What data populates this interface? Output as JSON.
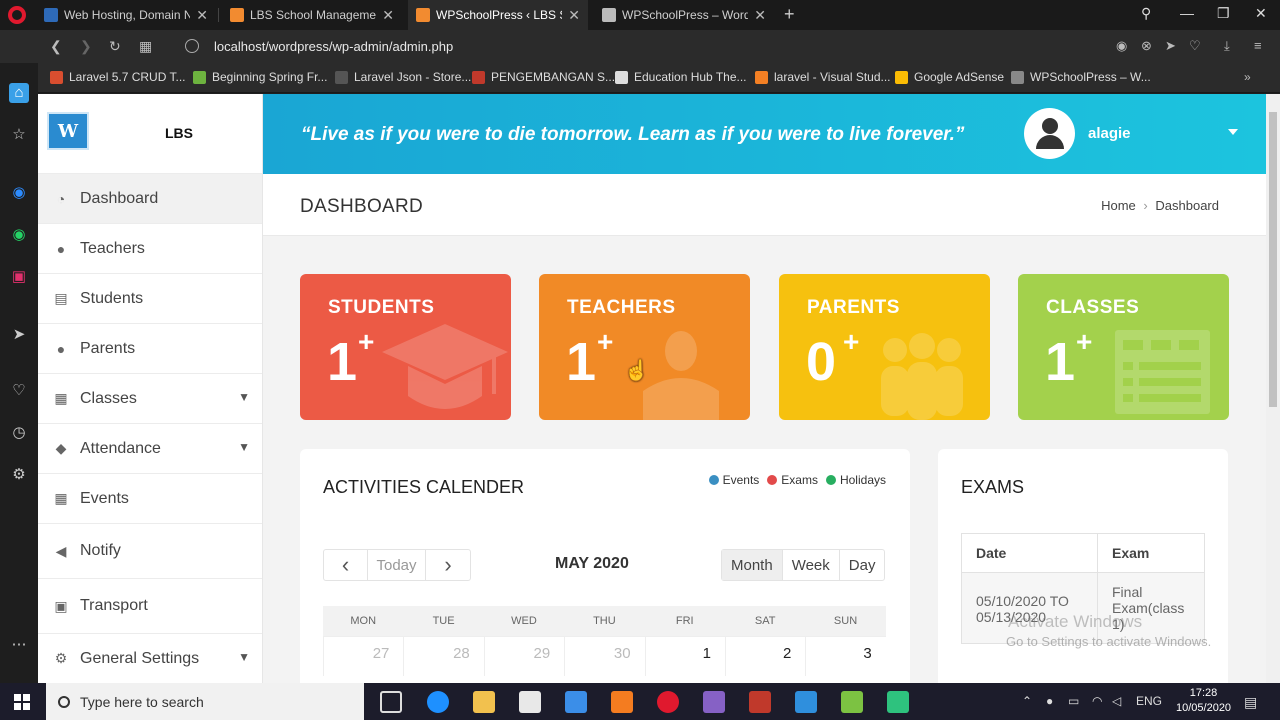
{
  "browser": {
    "tabs": [
      {
        "title": "Web Hosting, Domain Nam",
        "favicon_color": "#2e6ab8"
      },
      {
        "title": "LBS School Management S",
        "favicon_color": "#f28b30"
      },
      {
        "title": "WPSchoolPress ‹ LBS Scho",
        "favicon_color": "#f28b30"
      },
      {
        "title": "WPSchoolPress – WordPres",
        "favicon_color": "#bbbbbb"
      }
    ],
    "url": "localhost/wordpress/wp-admin/admin.php",
    "bookmarks": [
      {
        "label": "Laravel 5.7 CRUD T...",
        "color": "#d94e2f"
      },
      {
        "label": "Beginning Spring Fr...",
        "color": "#6db33f"
      },
      {
        "label": "Laravel Json - Store...",
        "color": "#555555"
      },
      {
        "label": "PENGEMBANGAN S...",
        "color": "#c0392b"
      },
      {
        "label": "Education Hub The...",
        "color": "#dddddd"
      },
      {
        "label": "laravel - Visual Stud...",
        "color": "#f48024"
      },
      {
        "label": "Google AdSense",
        "color": "#fbbc04"
      },
      {
        "label": "WPSchoolPress – W...",
        "color": "#888888"
      }
    ]
  },
  "sidebar": {
    "brand": "LBS",
    "logo_text": "W",
    "items": [
      {
        "label": "Dashboard",
        "icon": "dashboard-icon",
        "glyph": "◔",
        "has_submenu": false
      },
      {
        "label": "Teachers",
        "icon": "user-icon",
        "glyph": "●",
        "has_submenu": false
      },
      {
        "label": "Students",
        "icon": "id-card-icon",
        "glyph": "▤",
        "has_submenu": false
      },
      {
        "label": "Parents",
        "icon": "parent-icon",
        "glyph": "●",
        "has_submenu": false
      },
      {
        "label": "Classes",
        "icon": "table-icon",
        "glyph": "▦",
        "has_submenu": true
      },
      {
        "label": "Attendance",
        "icon": "tag-icon",
        "glyph": "◆",
        "has_submenu": true
      },
      {
        "label": "Events",
        "icon": "calendar-icon",
        "glyph": "▦",
        "has_submenu": false
      },
      {
        "label": "Notify",
        "icon": "megaphone-icon",
        "glyph": "◀",
        "has_submenu": false
      },
      {
        "label": "Transport",
        "icon": "bus-icon",
        "glyph": "▣",
        "has_submenu": false
      },
      {
        "label": "General Settings",
        "icon": "gear-icon",
        "glyph": "⚙",
        "has_submenu": true
      }
    ]
  },
  "header": {
    "quote": "“Live as if you were to die tomorrow. Learn as if you were to live forever.”",
    "username": "alagie"
  },
  "titlebar": {
    "title": "DASHBOARD",
    "breadcrumb_home": "Home",
    "breadcrumb_sep": "›",
    "breadcrumb_current": "Dashboard"
  },
  "stats": [
    {
      "label": "STUDENTS",
      "count": "1",
      "plus": "+",
      "color": "#ec5a45",
      "icon": "graduation-cap-icon"
    },
    {
      "label": "TEACHERS",
      "count": "1",
      "plus": "+",
      "color": "#f18a26",
      "icon": "teacher-icon"
    },
    {
      "label": "PARENTS",
      "count": "0",
      "plus": "+",
      "color": "#f6c10f",
      "icon": "family-icon"
    },
    {
      "label": "CLASSES",
      "count": "1",
      "plus": "+",
      "color": "#a3d14c",
      "icon": "timetable-icon"
    }
  ],
  "calendar": {
    "title": "ACTIVITIES CALENDER",
    "legend": [
      {
        "label": "Events",
        "color": "#3a8fc2"
      },
      {
        "label": "Exams",
        "color": "#e24a4a"
      },
      {
        "label": "Holidays",
        "color": "#27ae60"
      }
    ],
    "nav": {
      "prev": "‹",
      "today": "Today",
      "next": "›"
    },
    "month": "MAY 2020",
    "views": [
      "Month",
      "Week",
      "Day"
    ],
    "active_view": "Month",
    "weekdays": [
      "MON",
      "TUE",
      "WED",
      "THU",
      "FRI",
      "SAT",
      "SUN"
    ],
    "first_week": [
      {
        "day": "27",
        "dim": true
      },
      {
        "day": "28",
        "dim": true
      },
      {
        "day": "29",
        "dim": true
      },
      {
        "day": "30",
        "dim": true
      },
      {
        "day": "1",
        "dim": false
      },
      {
        "day": "2",
        "dim": false
      },
      {
        "day": "3",
        "dim": false
      }
    ]
  },
  "exams": {
    "title": "EXAMS",
    "columns": [
      "Date",
      "Exam"
    ],
    "rows": [
      {
        "date": "05/10/2020 TO 05/13/2020",
        "exam": "Final Exam(class 1)"
      }
    ]
  },
  "watermark": {
    "line1": "Activate Windows",
    "line2": "Go to Settings to activate Windows."
  },
  "taskbar": {
    "search_placeholder": "Type here to search",
    "language": "ENG",
    "time": "17:28",
    "date": "10/05/2020"
  }
}
